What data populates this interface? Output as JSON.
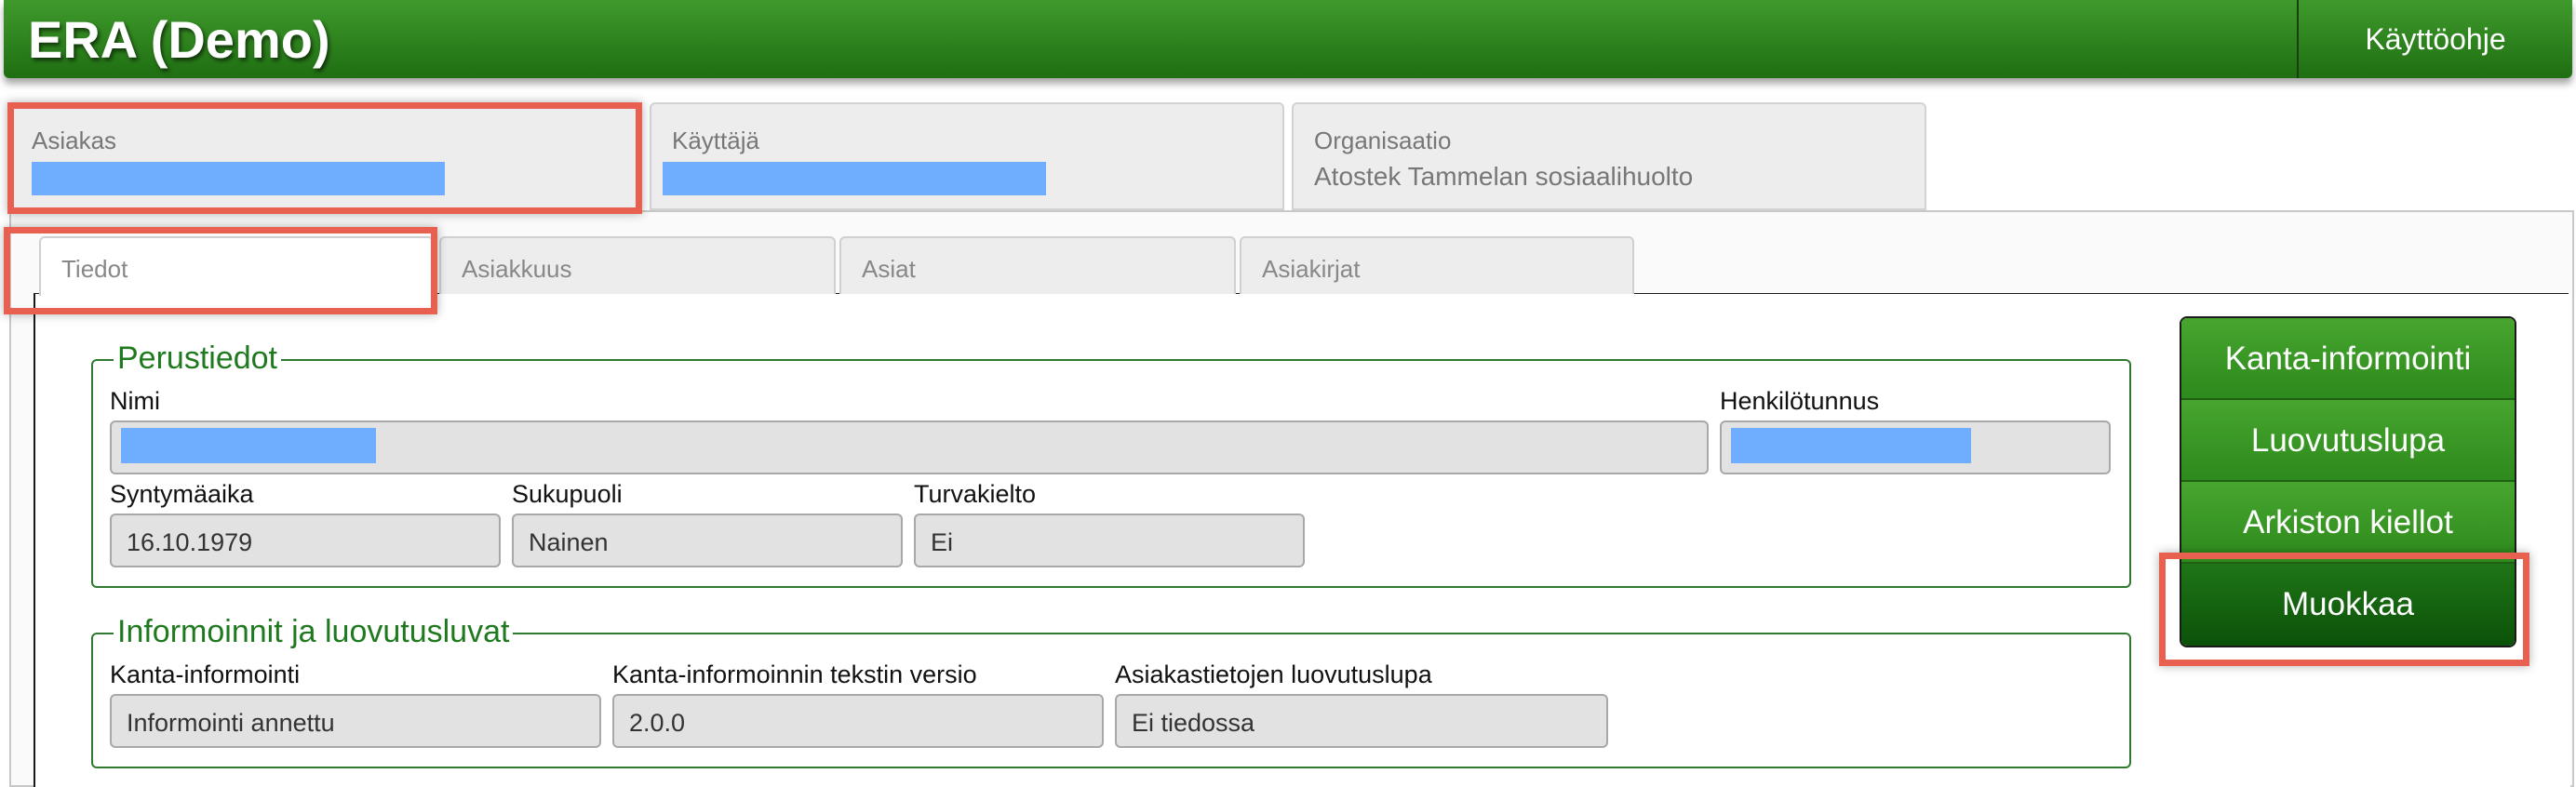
{
  "header": {
    "title": "ERA (Demo)",
    "help_link": "Käyttöohje"
  },
  "context": {
    "asiakas": {
      "label": "Asiakas"
    },
    "kayttaja": {
      "label": "Käyttäjä"
    },
    "organisaatio": {
      "label": "Organisaatio",
      "value": "Atostek Tammelan sosiaalihuolto"
    }
  },
  "tabs": [
    {
      "label": "Tiedot",
      "active": true
    },
    {
      "label": "Asiakkuus"
    },
    {
      "label": "Asiat"
    },
    {
      "label": "Asiakirjat"
    }
  ],
  "perustiedot": {
    "legend": "Perustiedot",
    "nimi_label": "Nimi",
    "hetu_label": "Henkilötunnus",
    "syntymaaika_label": "Syntymäaika",
    "syntymaaika_value": "16.10.1979",
    "sukupuoli_label": "Sukupuoli",
    "sukupuoli_value": "Nainen",
    "turvakielto_label": "Turvakielto",
    "turvakielto_value": "Ei"
  },
  "informoinnit": {
    "legend": "Informoinnit ja luovutusluvat",
    "kanta_label": "Kanta-informointi",
    "kanta_value": "Informointi annettu",
    "versio_label": "Kanta-informoinnin tekstin versio",
    "versio_value": "2.0.0",
    "luovutuslupa_label": "Asiakastietojen luovutuslupa",
    "luovutuslupa_value": "Ei tiedossa"
  },
  "actions": {
    "kanta": "Kanta-informointi",
    "luovutuslupa": "Luovutuslupa",
    "arkisto": "Arkiston kiellot",
    "muokkaa": "Muokkaa"
  },
  "colors": {
    "accent_green": "#2d8a1c",
    "highlight_red": "#e8604f",
    "redaction_blue": "#6fadff"
  }
}
